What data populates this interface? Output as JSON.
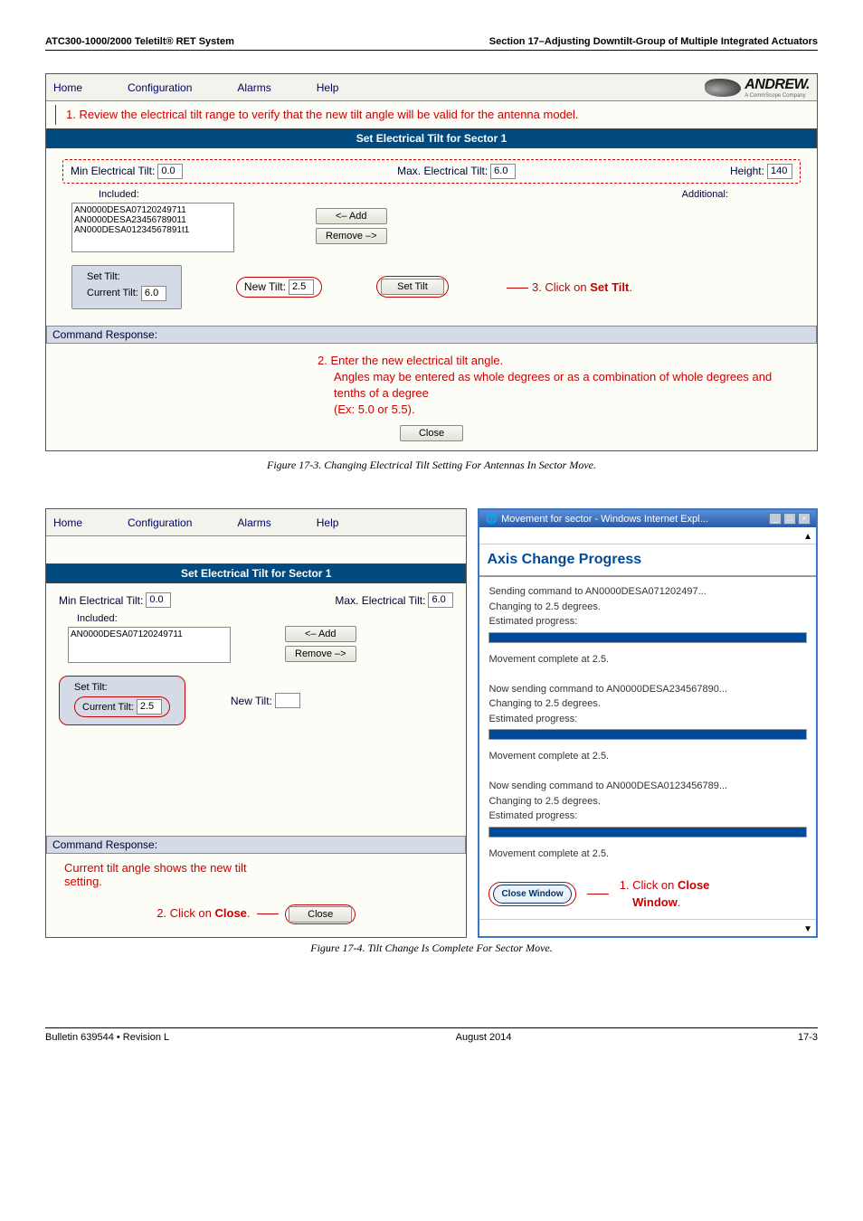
{
  "doc_header": {
    "left": "ATC300-1000/2000 Teletilt® RET System",
    "right": "Section 17–Adjusting Downtilt-Group of Multiple Integrated Actuators"
  },
  "fig1": {
    "menu": {
      "home": "Home",
      "config": "Configuration",
      "alarms": "Alarms",
      "help": "Help"
    },
    "logo": "ANDREW.",
    "logo_sub": "A CommScope Company",
    "review": "1. Review the electrical tilt range to verify that the new tilt angle will be valid for the antenna model.",
    "banner": "Set Electrical Tilt for Sector 1",
    "min_label": "Min Electrical Tilt:",
    "min_val": "0.0",
    "max_label": "Max. Electrical Tilt:",
    "max_val": "6.0",
    "height_label": "Height:",
    "height_val": "140",
    "included": "Included:",
    "additional": "Additional:",
    "dev1": "AN0000DESA07120249711",
    "dev2": "AN0000DESA23456789011",
    "dev3": "AN000DESA01234567891t1",
    "add_btn": "<– Add",
    "remove_btn": "Remove –>",
    "set_tilt_title": "Set Tilt:",
    "current_tilt_label": "Current Tilt:",
    "current_tilt_val": "6.0",
    "new_tilt_label": "New Tilt:",
    "new_tilt_val": "2.5",
    "set_tilt_btn": "Set Tilt",
    "annot_settilt": "3. Click on Set Tilt.",
    "cmd_resp": "Command Response:",
    "annot2_a": "2.  Enter the new electrical tilt angle.",
    "annot2_b": "Angles may be entered as whole degrees or as a combination of whole degrees and tenths of a degree",
    "annot2_c": "(Ex: 5.0 or 5.5).",
    "close_btn": "Close",
    "caption": "Figure 17-3.  Changing Electrical Tilt Setting For Antennas In Sector Move."
  },
  "fig2": {
    "menu": {
      "home": "Home",
      "config": "Configuration",
      "alarms": "Alarms",
      "help": "Help"
    },
    "banner": "Set Electrical Tilt for Sector 1",
    "min_label": "Min Electrical Tilt:",
    "min_val": "0.0",
    "max_label": "Max. Electrical Tilt:",
    "max_val": "6.0",
    "included": "Included:",
    "dev1": "AN0000DESA07120249711",
    "add_btn": "<– Add",
    "remove_btn": "Remove –>",
    "set_tilt_title": "Set Tilt:",
    "current_tilt_label": "Current Tilt:",
    "current_tilt_val": "2.5",
    "new_tilt_label": "New Tilt:",
    "cmd_resp": "Command Response:",
    "annot_current": "Current tilt angle shows the new tilt setting.",
    "annot_close2": "2.  Click on Close.",
    "close_btn": "Close",
    "ie_title": "Movement for sector - Windows Internet Expl...",
    "axis_head": "Axis Change Progress",
    "p1_a": "Sending command to AN0000DESA071202497...",
    "p1_b": "Changing to 2.5 degrees.",
    "p1_c": "Estimated progress:",
    "mc": "Movement complete at 2.5.",
    "p2_a": "Now sending command to AN0000DESA234567890...",
    "p2_b": "Changing to 2.5 degrees.",
    "p2_c": "Estimated progress:",
    "p3_a": "Now sending command to AN000DESA0123456789...",
    "p3_b": "Changing to 2.5 degrees.",
    "p3_c": "Estimated progress:",
    "close_win": "Close Window",
    "annot_close1a": "1.  Click on",
    "annot_close1b": "Close Window",
    "annot_close1c": ".",
    "caption": "Figure 17-4.  Tilt Change Is Complete For Sector Move."
  },
  "footer": {
    "left": "Bulletin 639544  •  Revision L",
    "center": "August 2014",
    "right": "17-3"
  }
}
